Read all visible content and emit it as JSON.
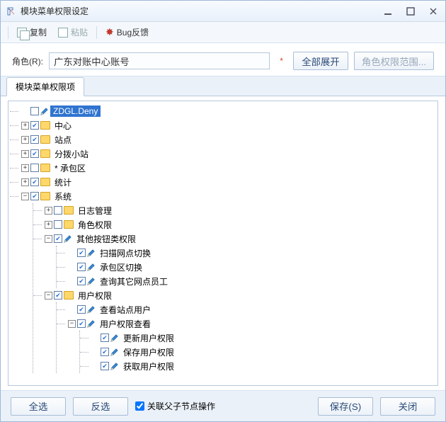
{
  "window": {
    "title": "模块菜单权限设定"
  },
  "toolbar": {
    "copy": "复制",
    "paste": "粘贴",
    "bug": "Bug反馈"
  },
  "form": {
    "role_label": "角色(R):",
    "role_value": "广东对账中心账号",
    "required": "*",
    "expand_all": "全部展开",
    "role_scope": "角色权限范围..."
  },
  "tabs": [
    "模块菜单权限项"
  ],
  "footer": {
    "select_all": "全选",
    "invert": "反选",
    "link_label": "关联父子节点操作",
    "link_checked": true,
    "save": "保存(S)",
    "close": "关闭"
  },
  "tree": [
    {
      "label": "ZDGL.Deny",
      "icon": "pencil",
      "checked": false,
      "selected": true,
      "exp": "none"
    },
    {
      "label": "中心",
      "icon": "folder",
      "checked": true,
      "exp": "plus"
    },
    {
      "label": "站点",
      "icon": "folder",
      "checked": true,
      "exp": "plus"
    },
    {
      "label": "分拨小站",
      "icon": "folder",
      "checked": true,
      "exp": "plus"
    },
    {
      "label": "* 承包区",
      "icon": "folder",
      "checked": false,
      "exp": "plus"
    },
    {
      "label": "统计",
      "icon": "folder",
      "checked": true,
      "exp": "plus"
    },
    {
      "label": "系统",
      "icon": "folder",
      "checked": true,
      "exp": "minus",
      "children": [
        {
          "label": "日志管理",
          "icon": "folder",
          "checked": false,
          "exp": "plus"
        },
        {
          "label": "角色权限",
          "icon": "folder",
          "checked": false,
          "exp": "plus"
        },
        {
          "label": "其他按钮类权限",
          "icon": "pencil",
          "checked": true,
          "exp": "minus",
          "children": [
            {
              "label": "扫描网点切换",
              "icon": "pencil",
              "checked": true,
              "exp": "none"
            },
            {
              "label": "承包区切换",
              "icon": "pencil",
              "checked": true,
              "exp": "none"
            },
            {
              "label": "查询其它网点员工",
              "icon": "pencil",
              "checked": true,
              "exp": "none"
            }
          ]
        },
        {
          "label": "用户权限",
          "icon": "folder",
          "checked": true,
          "exp": "minus",
          "children": [
            {
              "label": "查看站点用户",
              "icon": "pencil",
              "checked": true,
              "exp": "none"
            },
            {
              "label": "用户权限查看",
              "icon": "pencil",
              "checked": true,
              "exp": "minus",
              "children": [
                {
                  "label": "更新用户权限",
                  "icon": "pencil",
                  "checked": true,
                  "exp": "none"
                },
                {
                  "label": "保存用户权限",
                  "icon": "pencil",
                  "checked": true,
                  "exp": "none"
                },
                {
                  "label": "获取用户权限",
                  "icon": "pencil",
                  "checked": true,
                  "exp": "none"
                }
              ]
            }
          ]
        }
      ]
    }
  ]
}
